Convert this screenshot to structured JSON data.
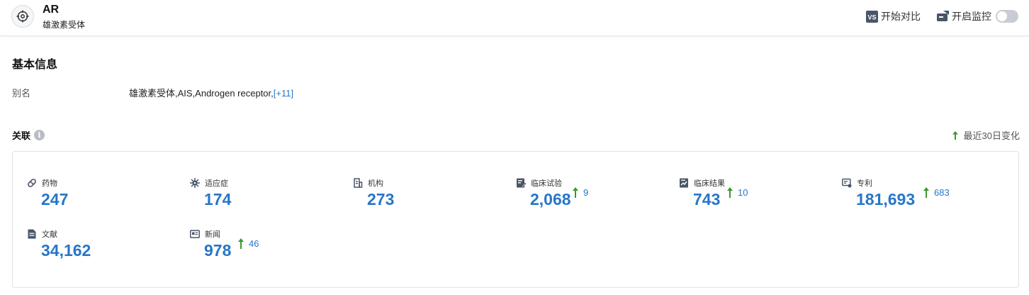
{
  "header": {
    "title": "AR",
    "subtitle": "雄激素受体",
    "compare_label": "开始对比",
    "monitor_label": "开启监控",
    "monitor_enabled": false
  },
  "basic": {
    "section_title": "基本信息",
    "alias_label": "别名",
    "alias_value": "雄激素受体,AIS,Androgen receptor,",
    "alias_more": "[+11]"
  },
  "assoc": {
    "title": "关联",
    "info_icon": "i",
    "recent_label": "最近30日变化",
    "colors": {
      "value": "#2776c9",
      "up_arrow": "#3a9a2b"
    },
    "stats": [
      {
        "icon": "pill-icon",
        "label": "药物",
        "value": "247",
        "delta": ""
      },
      {
        "icon": "virus-icon",
        "label": "适应症",
        "value": "174",
        "delta": ""
      },
      {
        "icon": "building-icon",
        "label": "机构",
        "value": "273",
        "delta": ""
      },
      {
        "icon": "clinical-trial-icon",
        "label": "临床试验",
        "value": "2,068",
        "delta": "9"
      },
      {
        "icon": "clinical-result-icon",
        "label": "临床结果",
        "value": "743",
        "delta": "10"
      },
      {
        "icon": "patent-icon",
        "label": "专利",
        "value": "181,693",
        "delta": "683"
      },
      {
        "icon": "document-icon",
        "label": "文献",
        "value": "34,162",
        "delta": ""
      },
      {
        "icon": "news-icon",
        "label": "新闻",
        "value": "978",
        "delta": "46"
      }
    ]
  }
}
